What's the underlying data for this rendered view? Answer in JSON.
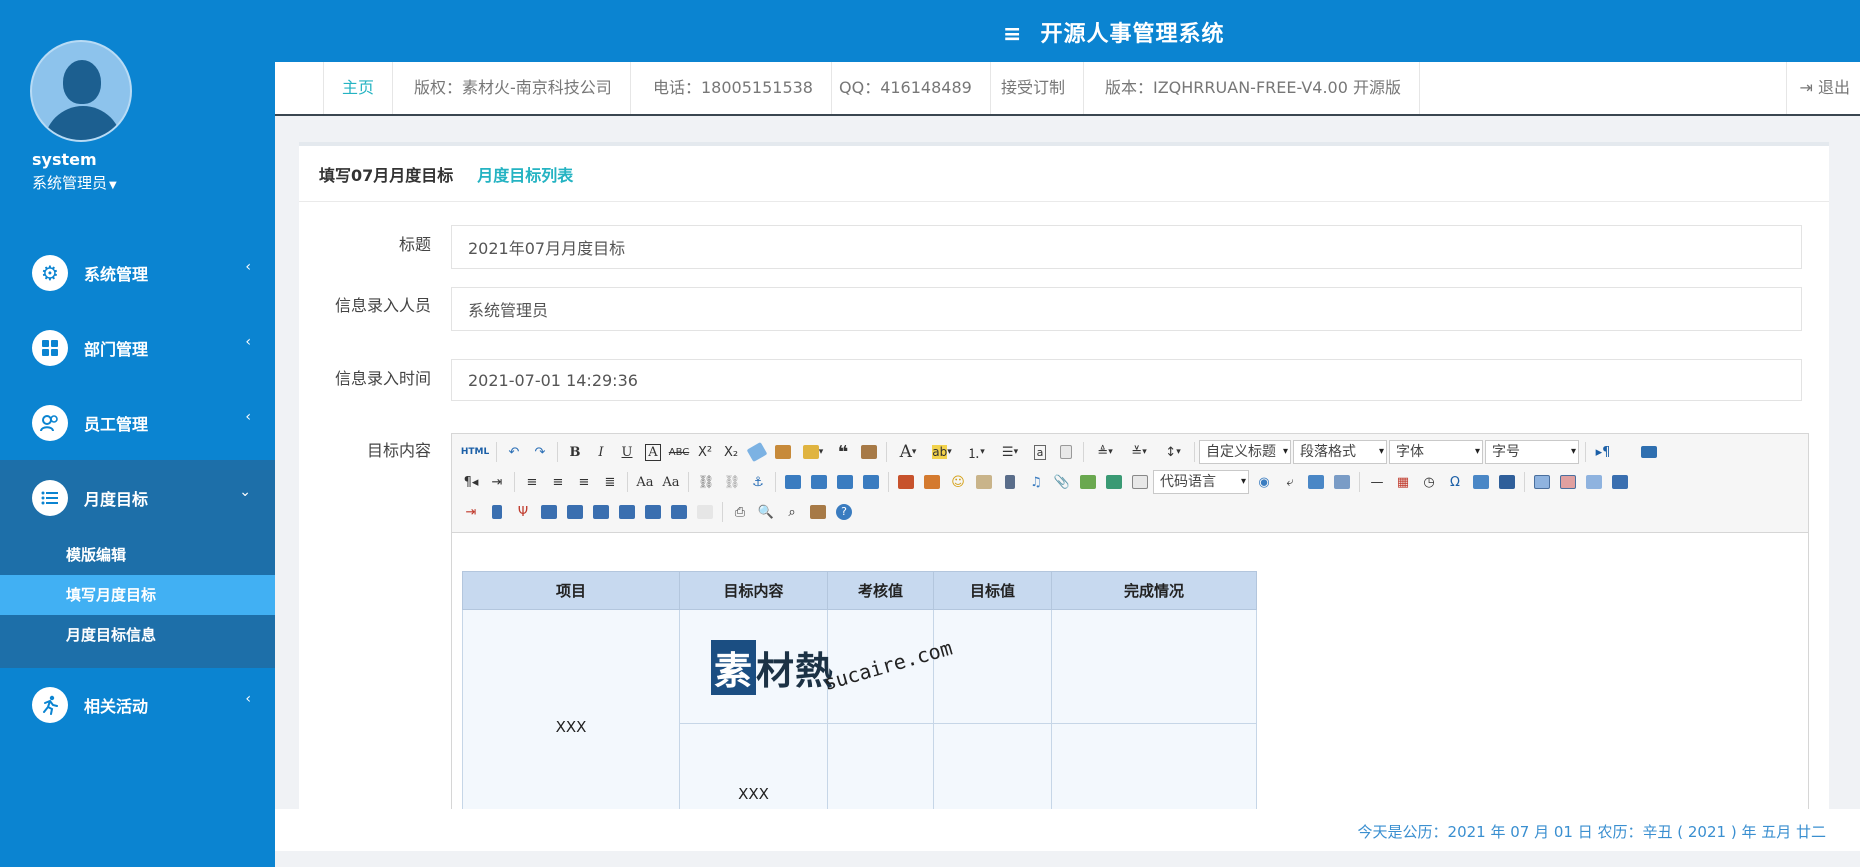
{
  "app": {
    "title": "开源人事管理系统"
  },
  "user": {
    "name": "system",
    "role": "系统管理员"
  },
  "sidebar": {
    "items": [
      {
        "label": "系统管理"
      },
      {
        "label": "部门管理"
      },
      {
        "label": "员工管理"
      },
      {
        "label": "月度目标"
      },
      {
        "label": "相关活动"
      }
    ],
    "sub_items": [
      {
        "label": "模版编辑"
      },
      {
        "label": "填写月度目标"
      },
      {
        "label": "月度目标信息"
      }
    ]
  },
  "nav": {
    "home": "主页",
    "copyright": "版权：素材火-南京科技公司",
    "phone": "电话：18005151538",
    "qq": "QQ：416148489",
    "custom": "接受订制",
    "version": "版本：IZQHRRUAN-FREE-V4.00 开源版",
    "logout": "退出"
  },
  "panel": {
    "title": "填写07月月度目标",
    "list_link": "月度目标列表"
  },
  "form": {
    "title_label": "标题",
    "title_value": "2021年07月月度目标",
    "entrant_label": "信息录入人员",
    "entrant_value": "系统管理员",
    "time_label": "信息录入时间",
    "time_value": "2021-07-01 14:29:36",
    "content_label": "目标内容"
  },
  "editor": {
    "selects": {
      "custom_title": "自定义标题",
      "paragraph": "段落格式",
      "font": "字体",
      "size": "字号",
      "code_lang": "代码语言"
    },
    "table": {
      "headers": [
        "项目",
        "目标内容",
        "考核值",
        "目标值",
        "完成情况"
      ],
      "project_value": "XXX",
      "content_value": "XXX"
    },
    "watermark": {
      "cn": "素材熱",
      "en": "sucaire.com"
    }
  },
  "footer": {
    "date_text": "今天是公历：2021 年 07 月 01 日   农历：辛丑 ( 2021 ) 年  五月 廿二"
  },
  "colors": {
    "primary": "#0b84d1",
    "active_sub": "#41b0f3",
    "accent": "#24b3c2",
    "table_header": "#c7d9ef"
  }
}
